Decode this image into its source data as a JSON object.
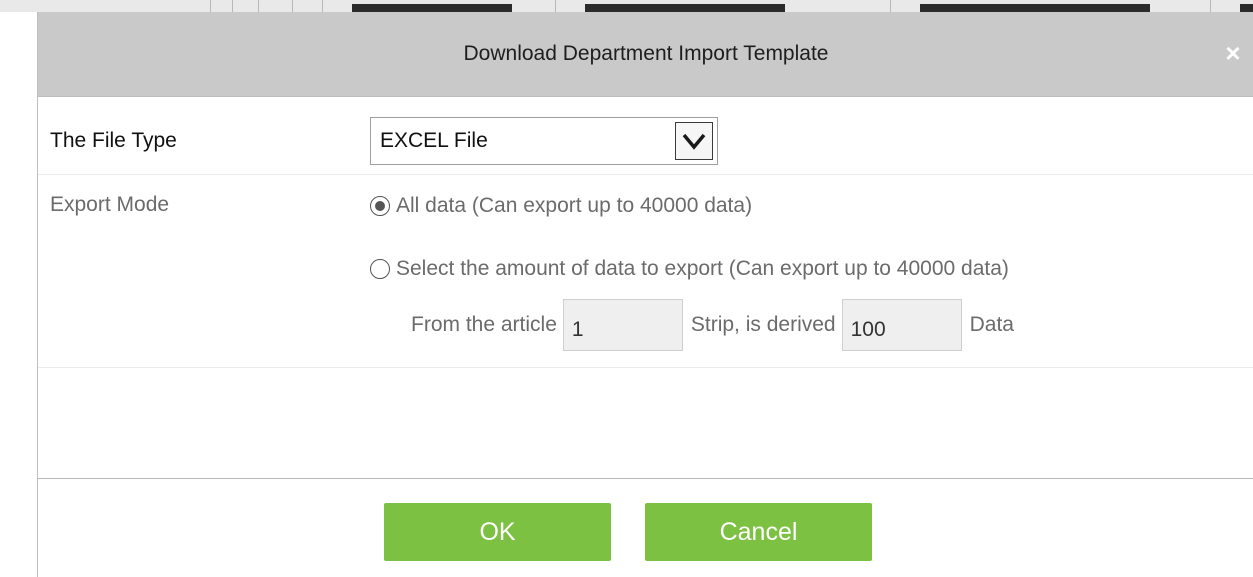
{
  "dialog": {
    "title": "Download Department Import Template",
    "close_symbol": "×",
    "file_type": {
      "label": "The File Type",
      "selected_value": "EXCEL File",
      "icon": "chevron-down-icon"
    },
    "export_mode": {
      "label": "Export Mode",
      "options": [
        {
          "label": "All data (Can export up to 40000 data)",
          "checked": true
        },
        {
          "label": "Select the amount of data to export (Can export up to 40000 data)",
          "checked": false
        }
      ],
      "range": {
        "from_label": "From the article",
        "from_value": "1",
        "strip_label": "Strip, is derived",
        "count_value": "100",
        "data_label": "Data"
      }
    },
    "buttons": {
      "ok_label": "OK",
      "cancel_label": "Cancel"
    }
  },
  "colors": {
    "titlebar": "#c9c9c9",
    "button_green": "#7cc142",
    "label_grey": "#6b6b6b"
  }
}
